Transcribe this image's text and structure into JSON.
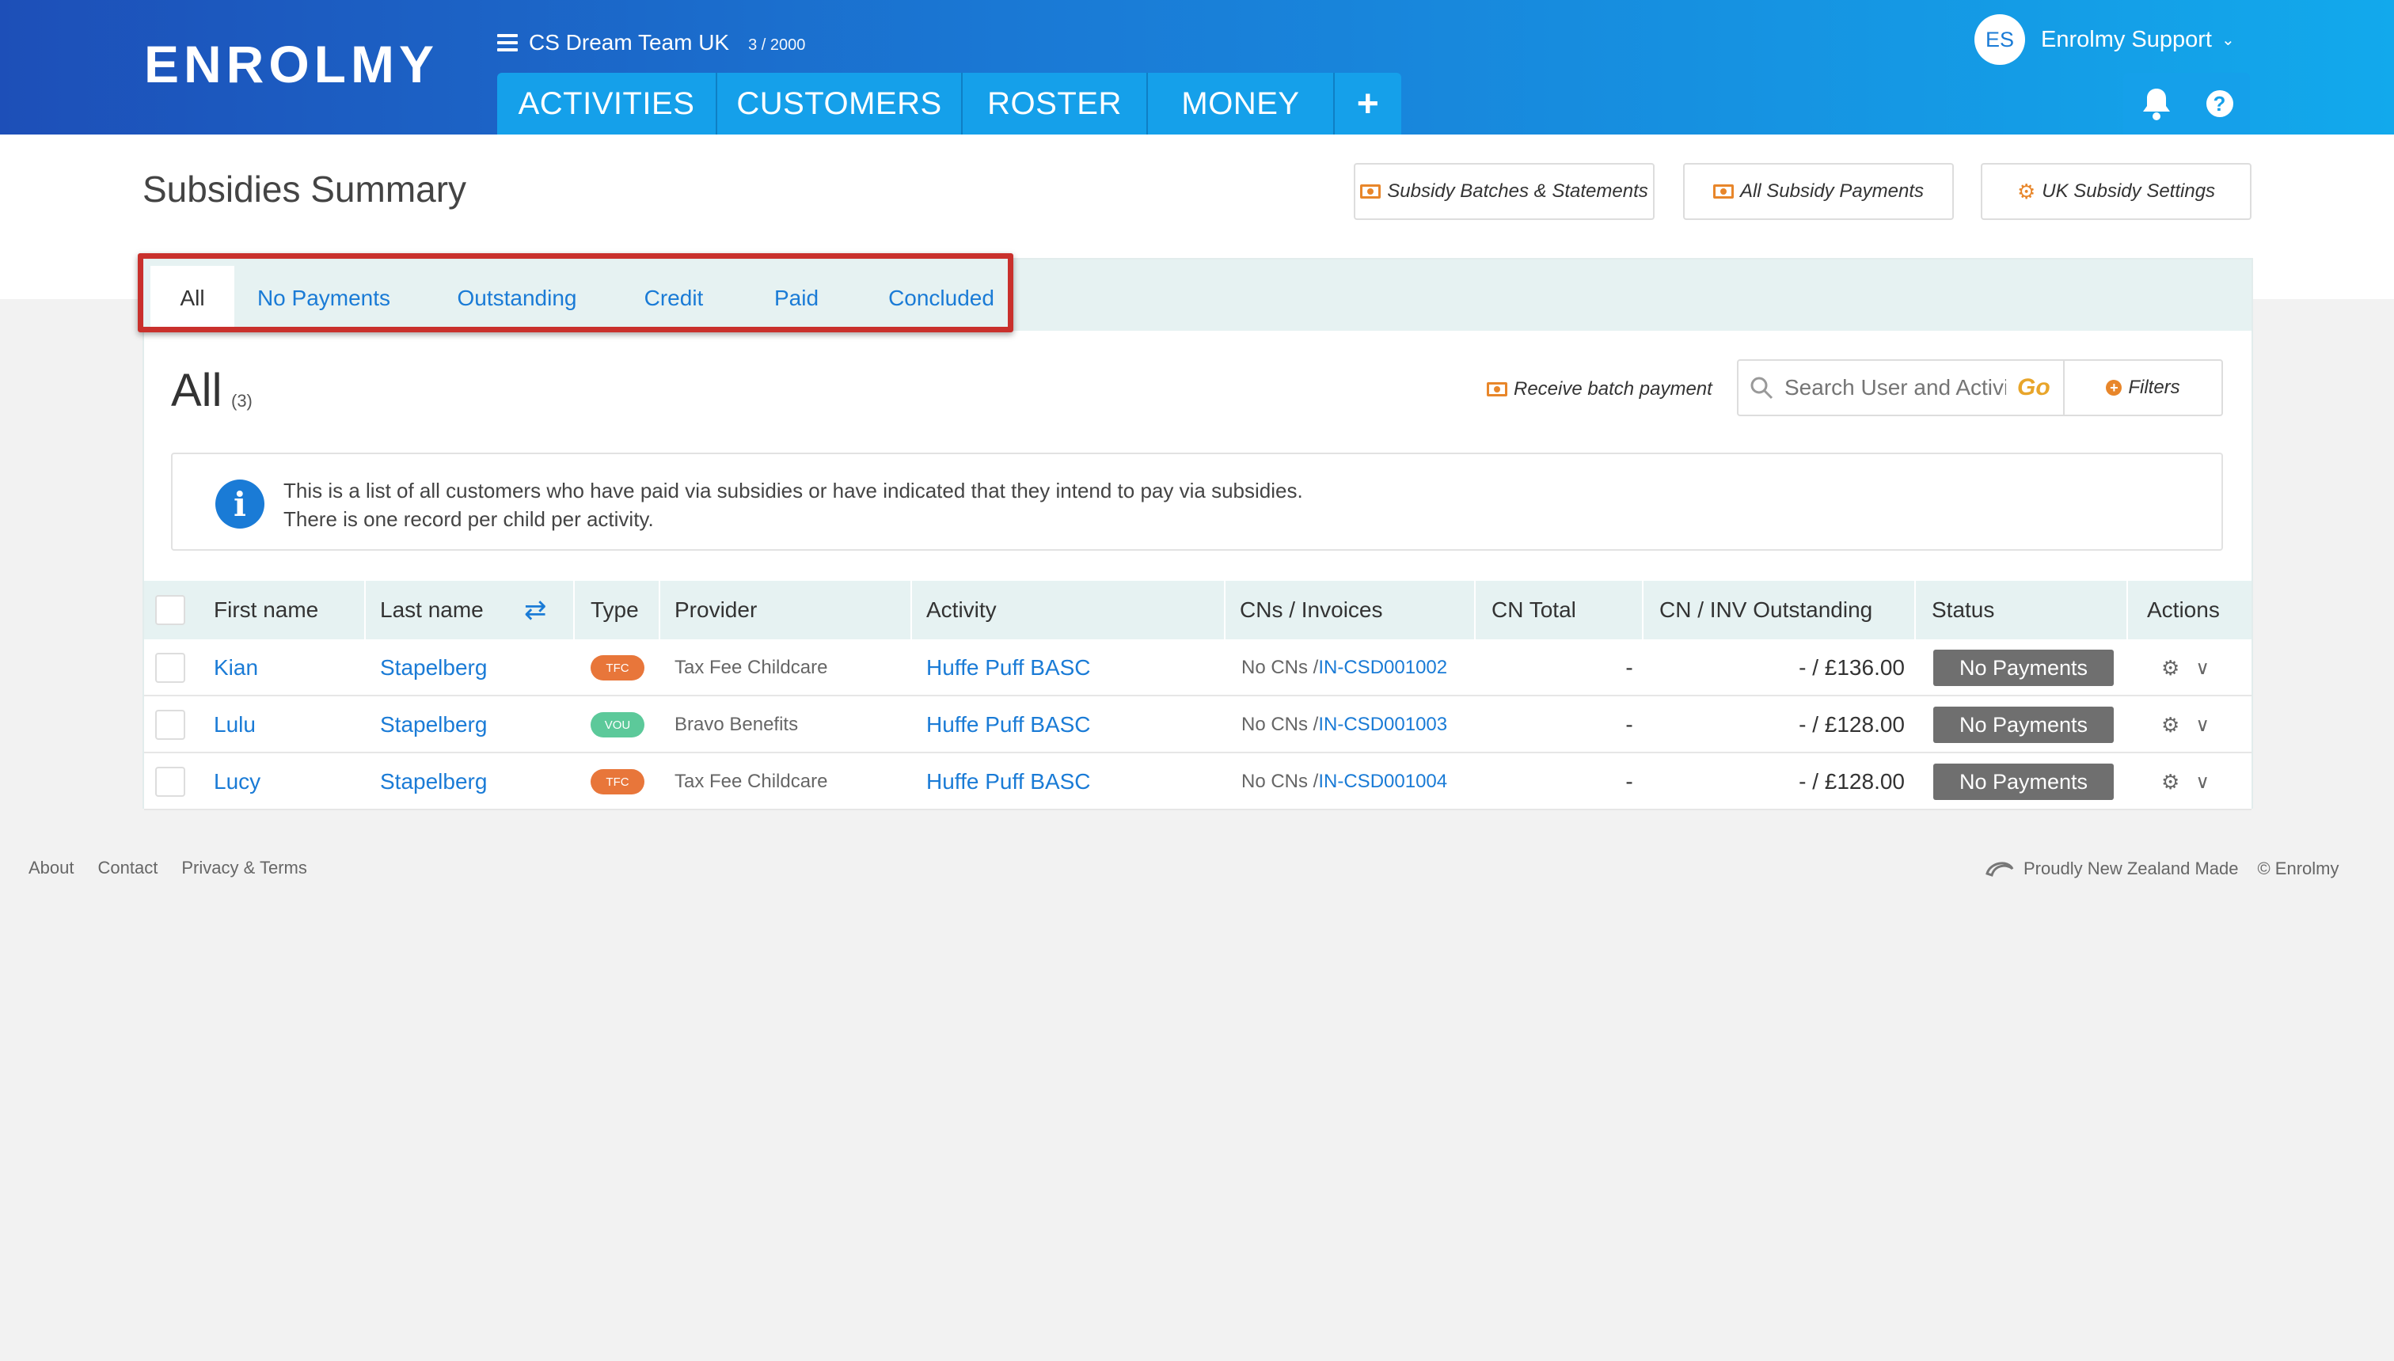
{
  "brand": {
    "logo": "ENROLMY"
  },
  "org": {
    "name": "CS Dream Team UK",
    "count": "3 / 2000"
  },
  "nav": {
    "items": [
      {
        "label": "ACTIVITIES"
      },
      {
        "label": "CUSTOMERS"
      },
      {
        "label": "ROSTER"
      },
      {
        "label": "MONEY"
      }
    ],
    "plus_label": "+"
  },
  "user": {
    "initials": "ES",
    "name": "Enrolmy Support",
    "caret": "⌄"
  },
  "help_label": "?",
  "page": {
    "title": "Subsidies Summary",
    "buttons": [
      {
        "label": "Subsidy Batches & Statements"
      },
      {
        "label": "All Subsidy Payments"
      },
      {
        "label": "UK Subsidy Settings"
      }
    ]
  },
  "tabs": [
    {
      "label": "All"
    },
    {
      "label": "No Payments"
    },
    {
      "label": "Outstanding"
    },
    {
      "label": "Credit"
    },
    {
      "label": "Paid"
    },
    {
      "label": "Concluded"
    }
  ],
  "section": {
    "title": "All",
    "count": "(3)"
  },
  "toolbar": {
    "batch_label": "Receive batch payment",
    "search_placeholder": "Search User and Activi",
    "go_label": "Go",
    "filters_label": "Filters"
  },
  "info": {
    "line1": "This is a list of all customers who have paid via subsidies or have indicated that they intend to pay via subsidies.",
    "line2": "There is one record per child per activity."
  },
  "table": {
    "columns": {
      "first_name": "First name",
      "last_name": "Last name",
      "type": "Type",
      "provider": "Provider",
      "activity": "Activity",
      "cns": "CNs / Invoices",
      "cn_total": "CN Total",
      "outstanding": "CN / INV Outstanding",
      "status": "Status",
      "actions": "Actions"
    },
    "rows": [
      {
        "first": "Kian",
        "last": "Stapelberg",
        "type": "TFC",
        "provider": "Tax Fee Childcare",
        "activity": "Huffe Puff BASC",
        "cn_prefix": "No CNs / ",
        "invoice": "IN-CSD001002",
        "cn_total": "-",
        "outstanding": "- / £136.00",
        "status": "No Payments"
      },
      {
        "first": "Lulu",
        "last": "Stapelberg",
        "type": "VOU",
        "provider": "Bravo Benefits",
        "activity": "Huffe Puff BASC",
        "cn_prefix": "No CNs / ",
        "invoice": "IN-CSD001003",
        "cn_total": "-",
        "outstanding": "- / £128.00",
        "status": "No Payments"
      },
      {
        "first": "Lucy",
        "last": "Stapelberg",
        "type": "TFC",
        "provider": "Tax Fee Childcare",
        "activity": "Huffe Puff BASC",
        "cn_prefix": "No CNs / ",
        "invoice": "IN-CSD001004",
        "cn_total": "-",
        "outstanding": "- / £128.00",
        "status": "No Payments"
      }
    ]
  },
  "footer": {
    "links": [
      {
        "label": "About"
      },
      {
        "label": "Contact"
      },
      {
        "label": "Privacy & Terms"
      }
    ],
    "made": "Proudly New Zealand Made",
    "copyright": "© Enrolmy"
  },
  "colors": {
    "accent": "#1a7bd6",
    "orange": "#e8862a",
    "tfc": "#e8763a",
    "vou": "#5cc99a",
    "highlight": "#c9302c"
  }
}
